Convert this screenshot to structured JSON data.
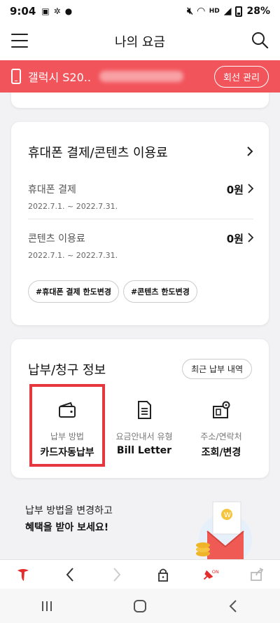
{
  "status": {
    "time": "9:04",
    "battery": "28%",
    "net": "HD"
  },
  "header": {
    "title": "나의 요금"
  },
  "line": {
    "device": "갤럭시 S20..",
    "manage_label": "회선 관리"
  },
  "payment_card": {
    "title": "휴대폰 결제/콘텐츠 이용료",
    "rows": [
      {
        "label": "휴대폰 결제",
        "period": "2022.7.1. ~ 2022.7.31.",
        "amount": "0원"
      },
      {
        "label": "콘텐츠 이용료",
        "period": "2022.7.1. ~ 2022.7.31.",
        "amount": "0원"
      }
    ],
    "tags": [
      "#휴대폰 결제 한도변경",
      "#콘텐츠 한도변경"
    ]
  },
  "billing_card": {
    "title": "납부/청구 정보",
    "recent_label": "최근 납부 내역",
    "items": [
      {
        "sub": "납부 방법",
        "main": "카드자동납부",
        "icon": "wallet-icon"
      },
      {
        "sub": "요금안내서 유형",
        "main": "Bill Letter",
        "icon": "document-icon"
      },
      {
        "sub": "주소/연락처",
        "main": "조회/변경",
        "icon": "address-icon"
      }
    ]
  },
  "promo": {
    "line1": "납부 방법을 변경하고",
    "line2": "혜택을 받아 보세요!"
  },
  "colors": {
    "accent": "#f2545b",
    "highlight_border": "#e6373f"
  }
}
